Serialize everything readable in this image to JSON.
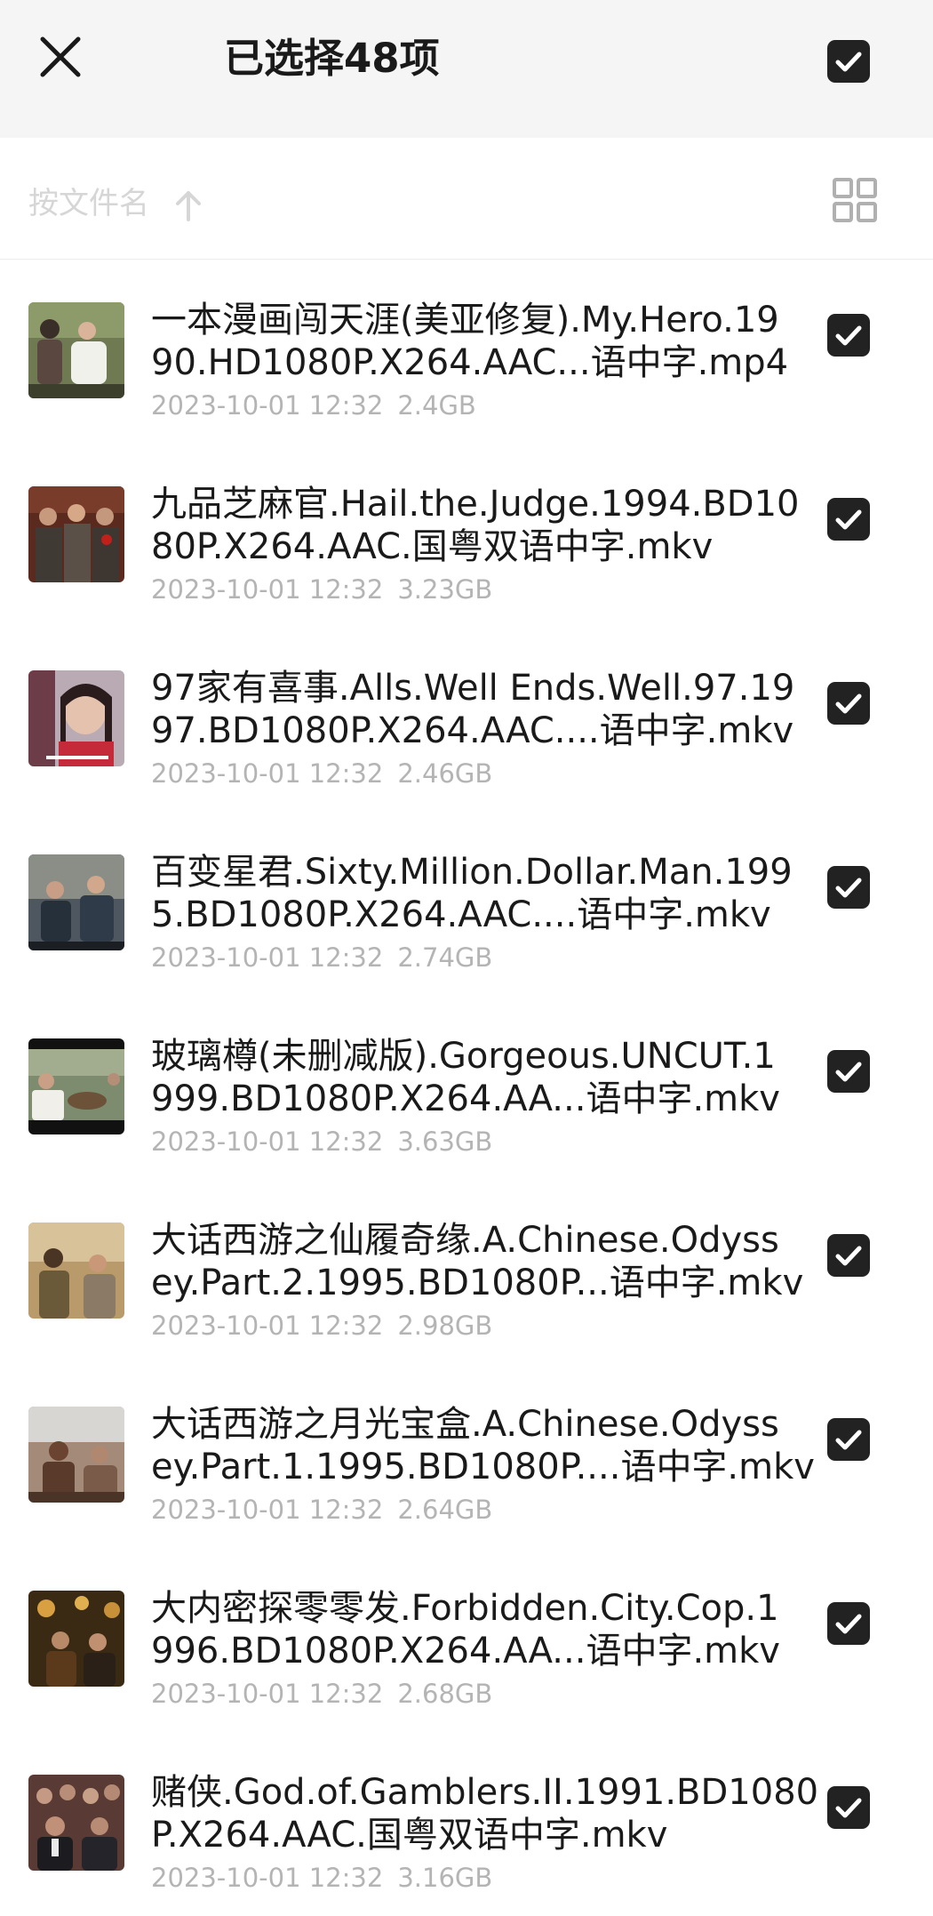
{
  "header": {
    "title": "已选择48项",
    "close_icon": "close-icon",
    "select_all_icon": "checkbox-checked-icon"
  },
  "sortbar": {
    "label": "按文件名",
    "sort_icon": "arrow-up-icon",
    "view_icon": "grid-view-icon"
  },
  "files": [
    {
      "name_line1": "一本漫画闯天涯(美亚修复).My.Hero.19",
      "name_line2": "90.HD1080P.X264.AAC...语中字.mp4",
      "date": "2023-10-01 12:32",
      "size": "2.4GB",
      "checked": true
    },
    {
      "name_line1": "九品芝麻官.Hail.the.Judge.1994.BD10",
      "name_line2": "80P.X264.AAC.国粤双语中字.mkv",
      "date": "2023-10-01 12:32",
      "size": "3.23GB",
      "checked": true
    },
    {
      "name_line1": "97家有喜事.Alls.Well Ends.Well.97.19",
      "name_line2": "97.BD1080P.X264.AAC....语中字.mkv",
      "date": "2023-10-01 12:32",
      "size": "2.46GB",
      "checked": true
    },
    {
      "name_line1": "百变星君.Sixty.Million.Dollar.Man.199",
      "name_line2": "5.BD1080P.X264.AAC....语中字.mkv",
      "date": "2023-10-01 12:32",
      "size": "2.74GB",
      "checked": true
    },
    {
      "name_line1": "玻璃樽(未删减版).Gorgeous.UNCUT.1",
      "name_line2": "999.BD1080P.X264.AA...语中字.mkv",
      "date": "2023-10-01 12:32",
      "size": "3.63GB",
      "checked": true
    },
    {
      "name_line1": "大话西游之仙履奇缘.A.Chinese.Odyss",
      "name_line2": "ey.Part.2.1995.BD1080P...语中字.mkv",
      "date": "2023-10-01 12:32",
      "size": "2.98GB",
      "checked": true
    },
    {
      "name_line1": "大话西游之月光宝盒.A.Chinese.Odyss",
      "name_line2": "ey.Part.1.1995.BD1080P....语中字.mkv",
      "date": "2023-10-01 12:32",
      "size": "2.64GB",
      "checked": true
    },
    {
      "name_line1": "大内密探零零发.Forbidden.City.Cop.1",
      "name_line2": "996.BD1080P.X264.AA...语中字.mkv",
      "date": "2023-10-01 12:32",
      "size": "2.68GB",
      "checked": true
    },
    {
      "name_line1": "赌侠.God.of.Gamblers.II.1991.BD1080",
      "name_line2": "P.X264.AAC.国粤双语中字.mkv",
      "date": "2023-10-01 12:32",
      "size": "3.16GB",
      "checked": true
    }
  ],
  "colors": {
    "header_bg": "#f5f5f5",
    "checkbox": "#222222",
    "meta_text": "#b4b4b4",
    "sort_text": "#d6d6d6"
  }
}
